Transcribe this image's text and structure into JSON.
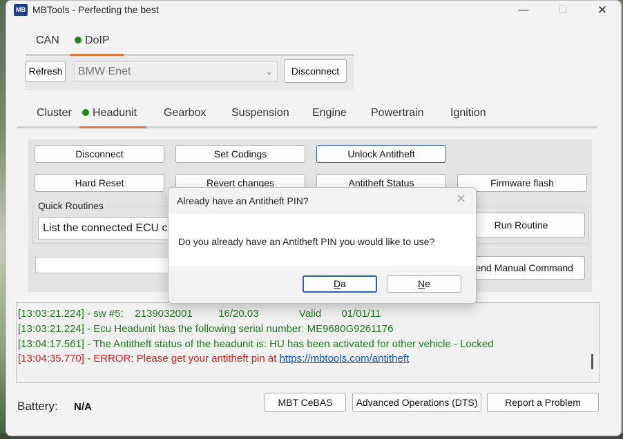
{
  "window": {
    "title": "MBTools - Perfecting the best",
    "logo_text": "MB"
  },
  "title_controls": {
    "minimize": "—",
    "maximize": "☐",
    "close": "✕"
  },
  "connection_tabs": [
    {
      "label": "CAN"
    },
    {
      "label": "DoIP",
      "active": true,
      "status_color": "#1a8a1a"
    }
  ],
  "connection": {
    "refresh_label": "Refresh",
    "interface_value": "BMW Enet",
    "disconnect_label": "Disconnect"
  },
  "ecu_tabs": [
    {
      "label": "Cluster"
    },
    {
      "label": "Headunit",
      "active": true,
      "status_color": "#1a8a1a"
    },
    {
      "label": "Gearbox"
    },
    {
      "label": "Suspension"
    },
    {
      "label": "Engine"
    },
    {
      "label": "Powertrain"
    },
    {
      "label": "Ignition"
    }
  ],
  "ecu_panel": {
    "buttons_row1": [
      "Disconnect",
      "Set Codings",
      "Unlock Antitheft"
    ],
    "buttons_row2": [
      "Hard Reset",
      "Revert changes",
      "Antitheft Status",
      "Firmware flash"
    ],
    "quick_routines_label": "Quick Routines",
    "routine_value": "List the connected ECU c",
    "run_routine_label": "Run Routine",
    "send_manual_label": "Send Manual Command"
  },
  "log": {
    "lines": [
      {
        "type": "ok",
        "text": "[13:03:21.224] - sw #5:    2139032001         16/20.03              Valid       01/01/11"
      },
      {
        "type": "ok",
        "text": "[13:03:21.224] - Ecu Headunit has the following serial number: ME9680G9261176"
      },
      {
        "type": "ok",
        "text": "[13:04:17.561] - The Antitheft status of the headunit is: HU has been activated for other vehicle - Locked"
      },
      {
        "type": "err",
        "text": "[13:04:35.770] - ERROR: Please get your antitheft pin at ",
        "link": "https://mbtools.com/antitheft"
      }
    ]
  },
  "footer": {
    "battery_label": "Battery:",
    "battery_value": "N/A",
    "buttons": [
      "MBT CeBAS",
      "Advanced Operations (DTS)",
      "Report a Problem"
    ]
  },
  "dialog": {
    "title": "Already have an Antitheft PIN?",
    "close": "✕",
    "message": "Do you already have an Antitheft PIN you would like to use?",
    "yes": {
      "mnemonic": "D",
      "rest": "a"
    },
    "no": {
      "mnemonic": "N",
      "rest": "e"
    }
  },
  "colors": {
    "accent_tab": "#e07a3a",
    "status_green": "#1a8a1a",
    "log_ok": "#1f7a1f",
    "log_error": "#d42020",
    "link": "#0b57d0",
    "dialog_default_border": "#2b5fb8"
  }
}
